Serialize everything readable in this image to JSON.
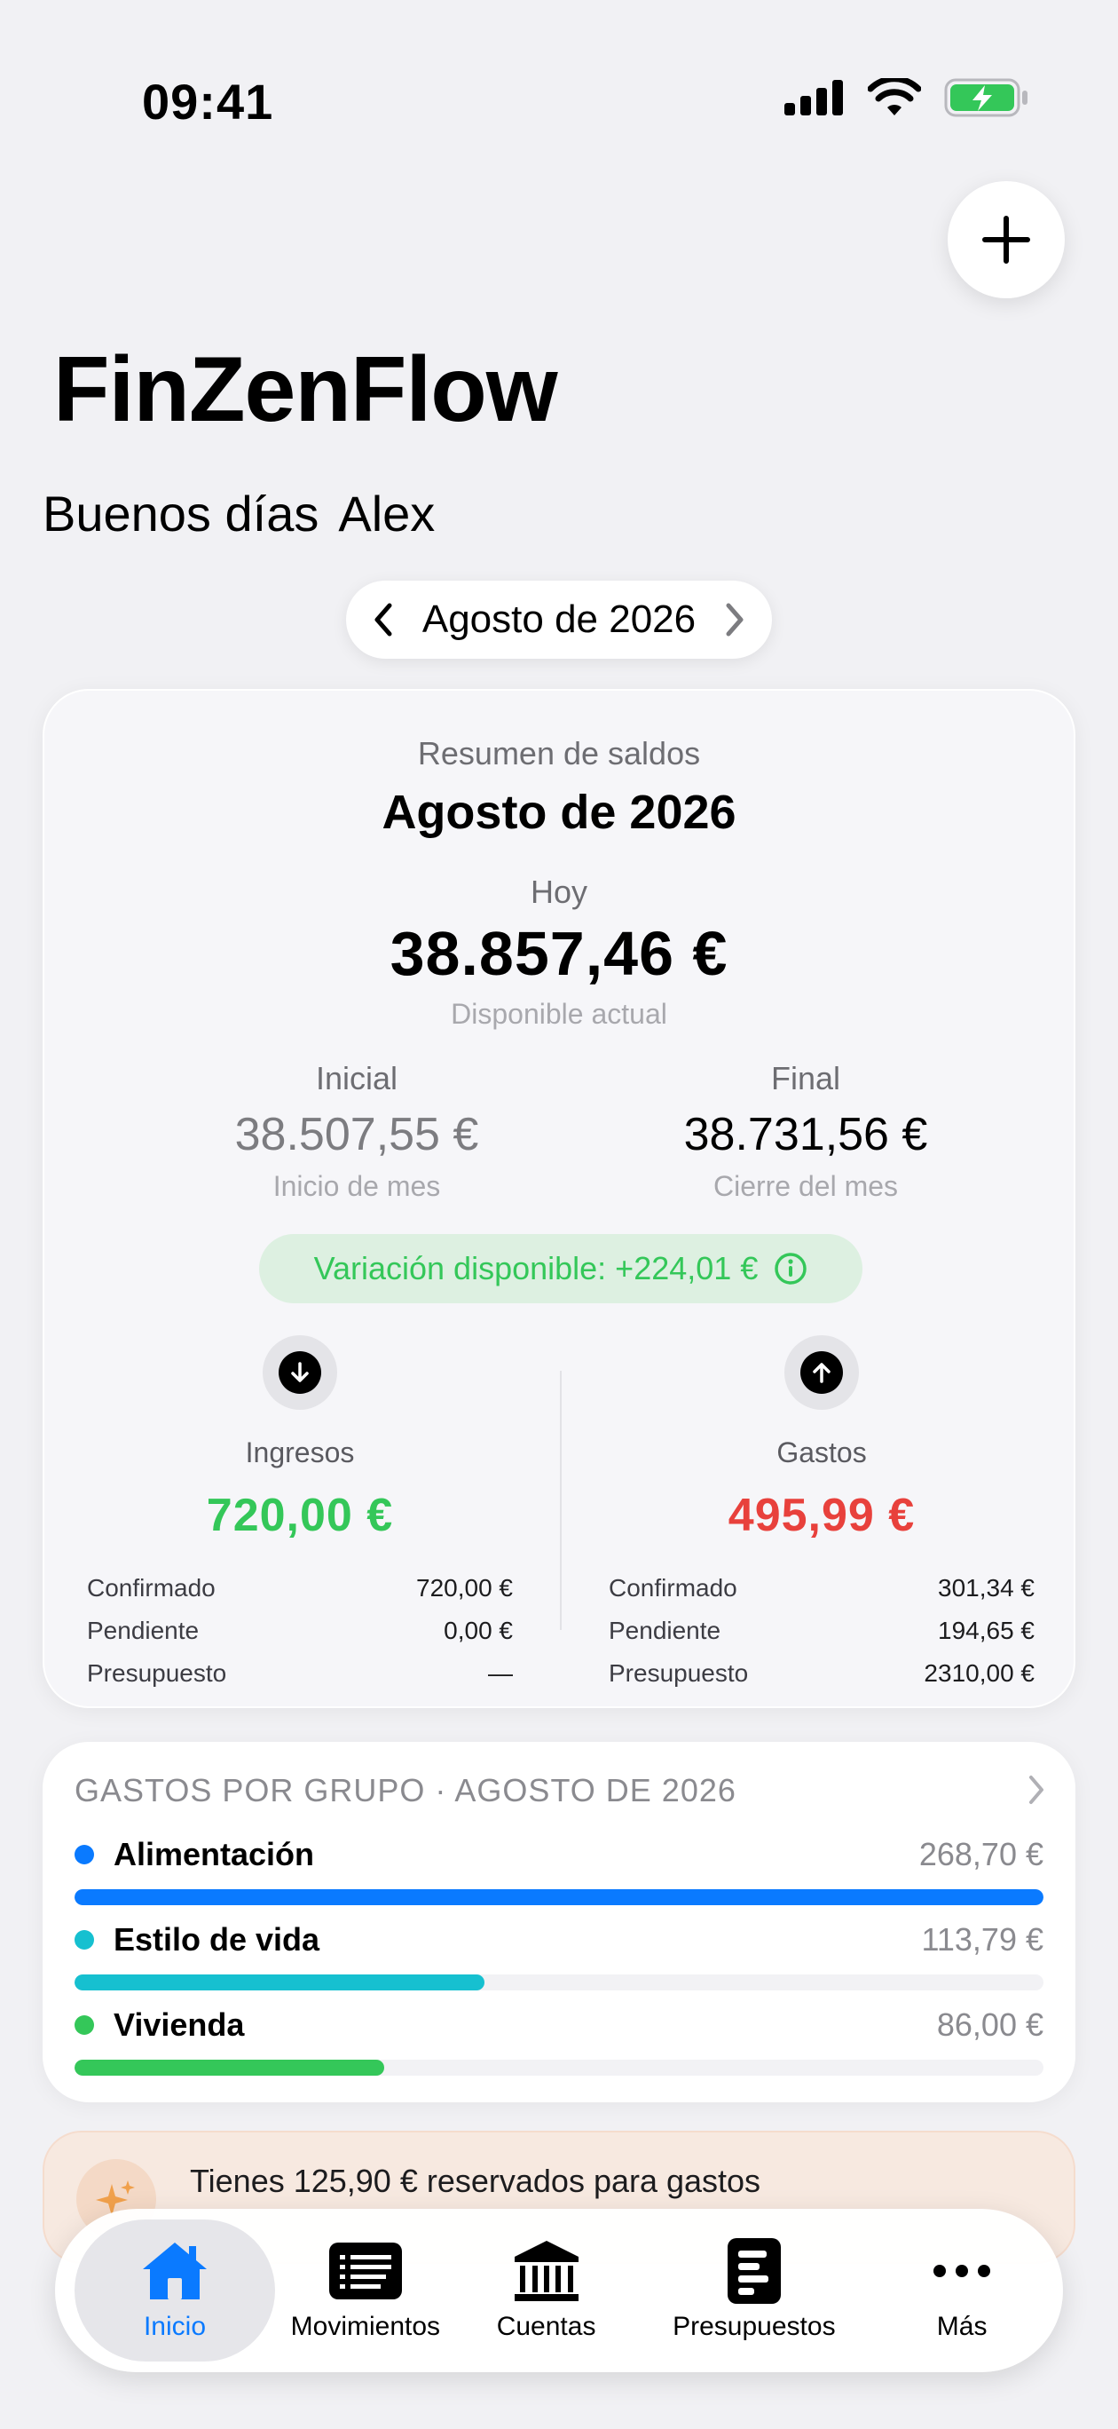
{
  "status_bar": {
    "time": "09:41",
    "icons": [
      "cellular-signal-icon",
      "wifi-icon",
      "battery-charging-icon"
    ]
  },
  "header": {
    "app_title": "FinZenFlow",
    "greeting_prefix": "Buenos días",
    "user_name": "Alex",
    "add_icon": "plus-icon"
  },
  "month_selector": {
    "label": "Agosto de 2026",
    "prev_icon": "chevron-left-icon",
    "next_icon": "chevron-right-icon"
  },
  "summary": {
    "subtitle": "Resumen de saldos",
    "title": "Agosto de 2026",
    "today_label": "Hoy",
    "today_balance": "38.857,46 €",
    "available_label": "Disponible actual",
    "initial": {
      "label": "Inicial",
      "value": "38.507,55 €",
      "sub": "Inicio de mes"
    },
    "final": {
      "label": "Final",
      "value": "38.731,56 €",
      "sub": "Cierre del mes"
    },
    "variation": "Variación disponible: +224,01 €",
    "income": {
      "label": "Ingresos",
      "value": "720,00 €",
      "rows": [
        {
          "label": "Confirmado",
          "value": "720,00 €"
        },
        {
          "label": "Pendiente",
          "value": "0,00 €"
        },
        {
          "label": "Presupuesto",
          "value": "—"
        }
      ]
    },
    "expenses": {
      "label": "Gastos",
      "value": "495,99 €",
      "rows": [
        {
          "label": "Confirmado",
          "value": "301,34 €"
        },
        {
          "label": "Pendiente",
          "value": "194,65 €"
        },
        {
          "label": "Presupuesto",
          "value": "2310,00 €"
        }
      ]
    },
    "colors": {
      "positive": "#34c759",
      "negative": "#e8413c"
    }
  },
  "groups": {
    "header": "GASTOS POR GRUPO · AGOSTO DE 2026",
    "items": [
      {
        "name": "Alimentación",
        "amount": "268,70 €",
        "color": "#0a7aff",
        "fraction": 1.0
      },
      {
        "name": "Estilo de vida",
        "amount": "113,79 €",
        "color": "#16c0d0",
        "fraction": 0.423
      },
      {
        "name": "Vivienda",
        "amount": "86,00 €",
        "color": "#34c759",
        "fraction": 0.32
      }
    ]
  },
  "reserved": {
    "text": "Tienes 125,90 € reservados para gastos",
    "icon": "sparkles-icon"
  },
  "tab_bar": {
    "tabs": [
      {
        "label": "Inicio",
        "icon": "house-icon",
        "active": true
      },
      {
        "label": "Movimientos",
        "icon": "list-icon",
        "active": false
      },
      {
        "label": "Cuentas",
        "icon": "bank-icon",
        "active": false
      },
      {
        "label": "Presupuestos",
        "icon": "document-icon",
        "active": false
      },
      {
        "label": "Más",
        "icon": "ellipsis-icon",
        "active": false
      }
    ]
  }
}
